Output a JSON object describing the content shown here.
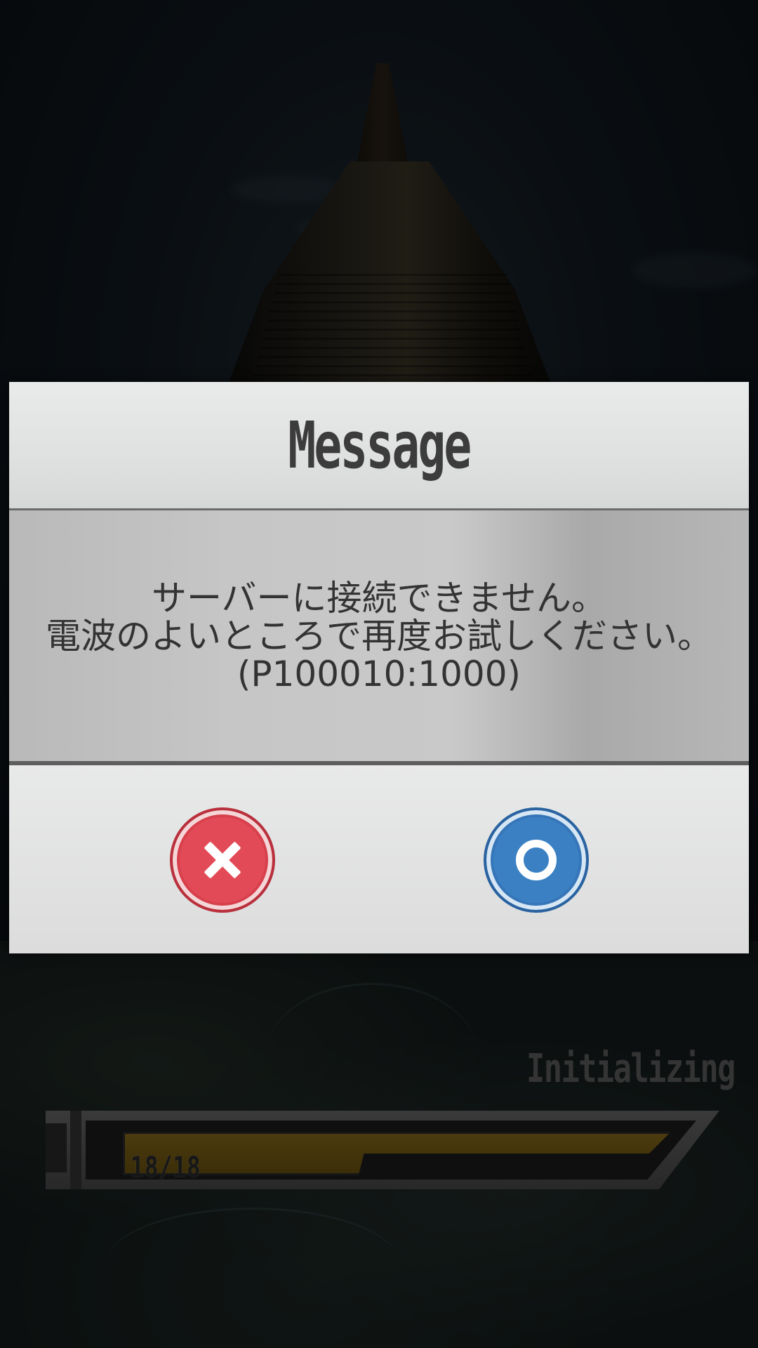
{
  "dialog": {
    "title": "Message",
    "message_lines": [
      "サーバーに接続できません。",
      "電波のよいところで再度お試しください。",
      "(P100010:1000)"
    ],
    "cancel_icon": "close-x-icon",
    "ok_icon": "confirm-circle-icon"
  },
  "loader": {
    "status": "Initializing",
    "progress_text": "18/18",
    "progress_fraction": 1.0
  },
  "colors": {
    "cancel": "#e34a57",
    "ok": "#3a80c3",
    "progress": "#8a6c1c"
  }
}
